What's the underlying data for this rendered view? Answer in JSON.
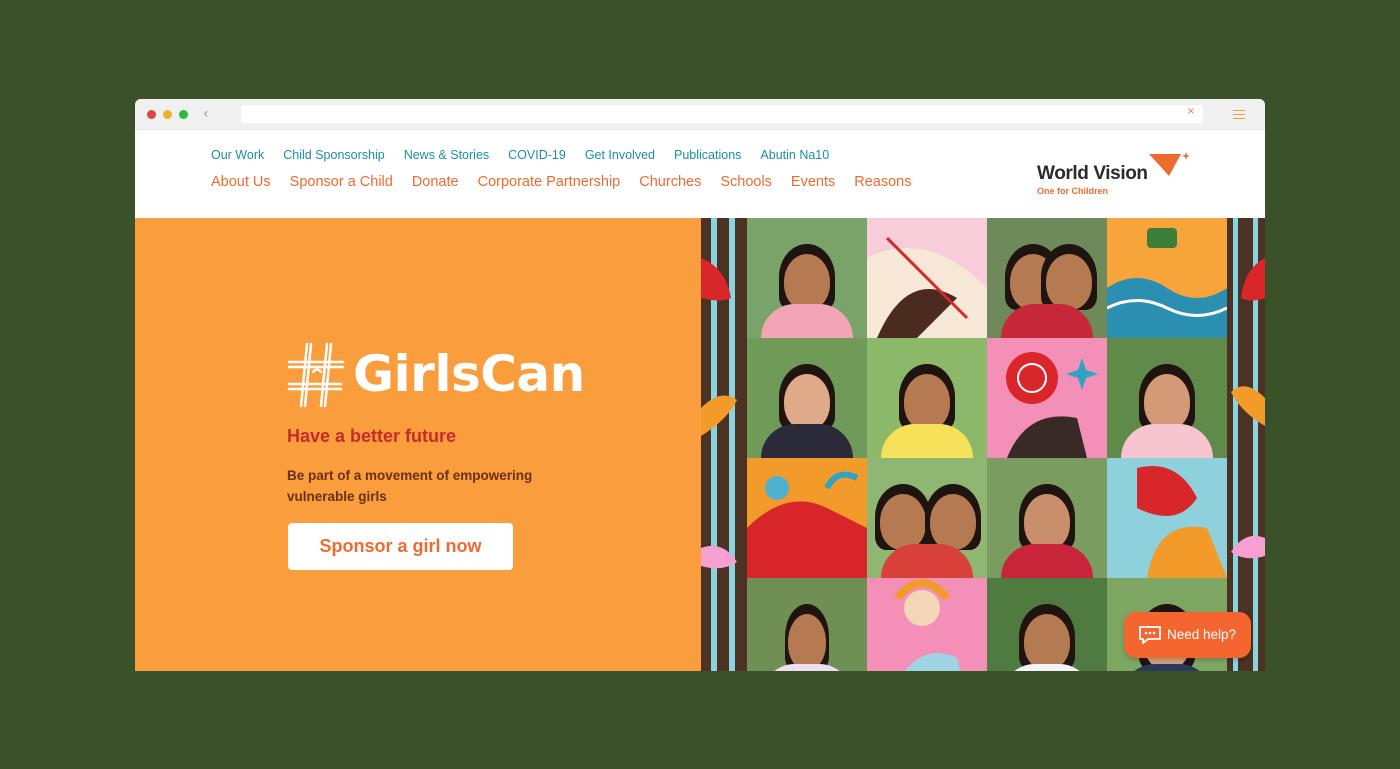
{
  "colors": {
    "background": "#3a5129",
    "hero_orange": "#fa9d3c",
    "nav_teal": "#1e8ea1",
    "nav_orange": "#ee6b2f",
    "subtitle_red": "#c72b2b",
    "help_button": "#f5652f"
  },
  "browser": {
    "url_value": "",
    "back_icon": "chevron-left-icon",
    "clear_icon": "close-icon",
    "menu_icon": "hamburger-icon"
  },
  "nav": {
    "top": [
      "Our Work",
      "Child Sponsorship",
      "News & Stories",
      "COVID-19",
      "Get Involved",
      "Publications",
      "Abutin Na10"
    ],
    "main": [
      "About Us",
      "Sponsor a Child",
      "Donate",
      "Corporate Partnership",
      "Churches",
      "Schools",
      "Events",
      "Reasons"
    ]
  },
  "logo": {
    "name": "World Vision",
    "tagline": "One for Children"
  },
  "hero": {
    "hashtag": "GirlsCan",
    "subtitle": "Have a better future",
    "description": "Be part of a movement of empowering vulnerable girls",
    "cta_label": "Sponsor a girl now"
  },
  "collage": {
    "tiles": [
      "photo-girl",
      "illustration-drawing",
      "photo-two-girls",
      "illustration-water-tap",
      "photo-girl-headscarf",
      "photo-girl-smiling",
      "illustration-sun-hands",
      "photo-girl",
      "illustration-figure",
      "photo-group-girls",
      "photo-girl-headband",
      "illustration-figure",
      "photo-young-girl",
      "illustration-girl",
      "photo-girl-uniform",
      "photo-girl"
    ]
  },
  "help": {
    "label": "Need help?",
    "icon": "chat-icon"
  }
}
